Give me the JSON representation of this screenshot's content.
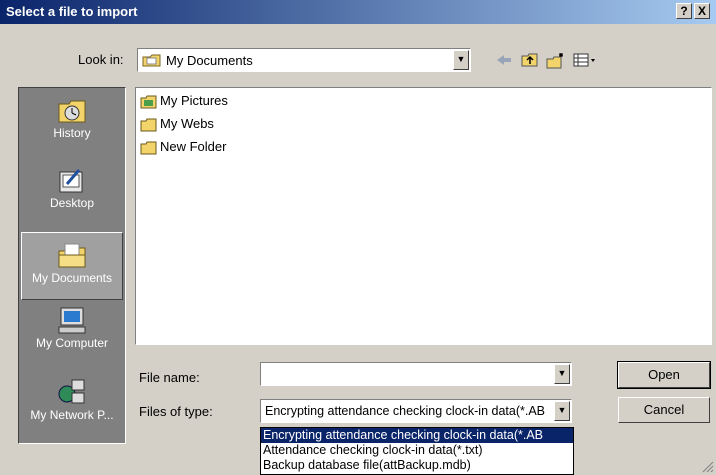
{
  "window": {
    "title": "Select a file to import",
    "help_glyph": "?",
    "close_glyph": "X"
  },
  "lookin": {
    "label": "Look in:",
    "value": "My Documents"
  },
  "toolbar": {
    "icons": [
      "back-arrow-icon",
      "up-folder-icon",
      "new-folder-icon",
      "view-menu-icon"
    ]
  },
  "places": [
    {
      "label": "History",
      "icon": "history-icon",
      "selected": false
    },
    {
      "label": "Desktop",
      "icon": "desktop-icon",
      "selected": false
    },
    {
      "label": "My Documents",
      "icon": "my-documents-icon",
      "selected": true
    },
    {
      "label": "My Computer",
      "icon": "my-computer-icon",
      "selected": false
    },
    {
      "label": "My Network P...",
      "icon": "network-places-icon",
      "selected": false
    }
  ],
  "files": [
    {
      "name": "My Pictures",
      "icon": "pictures-folder-icon"
    },
    {
      "name": "My Webs",
      "icon": "folder-icon"
    },
    {
      "name": "New Folder",
      "icon": "folder-icon"
    }
  ],
  "filename": {
    "label": "File name:",
    "value": ""
  },
  "filetype": {
    "label": "Files of type:",
    "value": "Encrypting attendance checking clock-in data(*.AB",
    "options": [
      "Encrypting attendance checking clock-in data(*.AB",
      "Attendance checking clock-in data(*.txt)",
      "Backup database file(attBackup.mdb)"
    ]
  },
  "buttons": {
    "open": "Open",
    "cancel": "Cancel"
  }
}
